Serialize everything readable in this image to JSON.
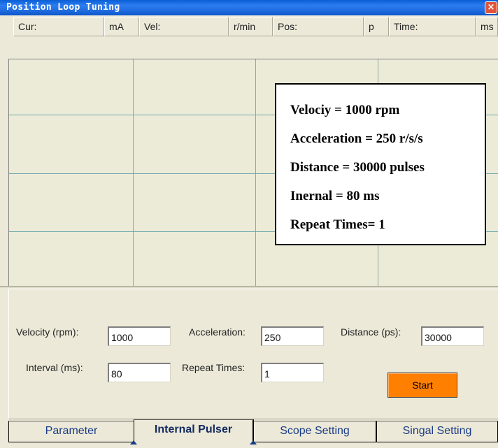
{
  "window": {
    "title": "Position Loop Tuning",
    "close_glyph": "×"
  },
  "status": {
    "cur_label": "Cur:",
    "cur_unit": "mA",
    "vel_label": "Vel:",
    "vel_unit": "r/min",
    "pos_label": "Pos:",
    "pos_unit": "p",
    "time_label": "Time:",
    "time_unit": "ms"
  },
  "info": [
    "Velociy = 1000 rpm",
    "Acceleration = 250 r/s/s",
    "Distance = 30000 pulses",
    "Inernal = 80 ms",
    "Repeat Times= 1"
  ],
  "form": {
    "velocity_label": "Velocity (rpm):",
    "velocity_value": "1000",
    "acceleration_label": "Acceleration:",
    "acceleration_value": "250",
    "distance_label": "Distance (ps):",
    "distance_value": "30000",
    "interval_label": "Interval (ms):",
    "interval_value": "80",
    "repeat_label": "Repeat Times:",
    "repeat_value": "1",
    "start_label": "Start"
  },
  "tabs": [
    "Parameter",
    "Internal Pulser",
    "Scope Setting",
    "Singal Setting"
  ],
  "active_tab": "Internal Pulser",
  "colors": {
    "title_bar": "#0a5fd6",
    "start_button": "#ff8000",
    "grid_line": "#6fa7ad",
    "tab_text": "#1a3c86"
  }
}
